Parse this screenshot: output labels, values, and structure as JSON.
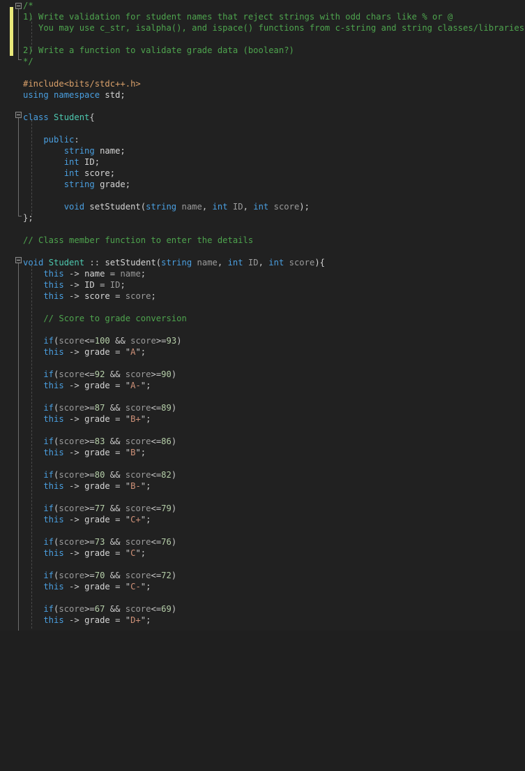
{
  "editor": {
    "language": "cpp",
    "theme": "dark",
    "background_color": "#212121",
    "change_indicator_color": "#E8E87A",
    "colors": {
      "comment": "#4EA44E",
      "keyword": "#4A9FE0",
      "type": "#4EC9B0",
      "string": "#CE9178",
      "number": "#B5CEA8",
      "identifier": "#D4D4D4",
      "parameter": "#9B9B9B",
      "punctuation": "#C8C8C8",
      "preprocessor": "#D9A06A"
    },
    "fold_markers": [
      {
        "name": "fold-comment-block",
        "line": 1
      },
      {
        "name": "fold-class-student",
        "line": 10
      },
      {
        "name": "fold-function-setstudent",
        "line": 23
      }
    ]
  },
  "code_lines": [
    "/*",
    "1) Write validation for student names that reject strings with odd chars like % or @",
    "   You may use c_str, isalpha(), and ispace() functions from c-string and string classes/libraries.",
    "",
    "",
    "2) Write a function to validate grade data (boolean?)",
    "*/",
    "",
    "#include<bits/stdc++.h>",
    "using namespace std;",
    "",
    "class Student{",
    "",
    "    public:",
    "        string name;",
    "        int ID;",
    "        int score;",
    "        string grade;",
    "",
    "        void setStudent(string name, int ID, int score);",
    "};",
    "",
    "// Class member function to enter the details",
    "",
    "void Student :: setStudent(string name, int ID, int score){",
    "    this -> name = name;",
    "    this -> ID = ID;",
    "    this -> score = score;",
    "",
    "    // Score to grade conversion",
    "",
    "    if(score<=100 && score>=93)",
    "    this -> grade = \"A\";",
    "",
    "    if(score<=92 && score>=90)",
    "    this -> grade = \"A-\";",
    "",
    "    if(score>=87 && score<=89)",
    "    this -> grade = \"B+\";",
    "",
    "    if(score>=83 && score<=86)",
    "    this -> grade = \"B\";",
    "",
    "    if(score>=80 && score<=82)",
    "    this -> grade = \"B-\";",
    "",
    "    if(score>=77 && score<=79)",
    "    this -> grade = \"C+\";",
    "",
    "    if(score>=73 && score<=76)",
    "    this -> grade = \"C\";",
    "",
    "    if(score>=70 && score<=72)",
    "    this -> grade = \"C-\";",
    "",
    "    if(score>=67 && score<=69)",
    "    this -> grade = \"D+\";"
  ],
  "grade_table": {
    "name": "score-to-grade-conversion",
    "rules": [
      {
        "grade": "A",
        "min": 93,
        "max": 100
      },
      {
        "grade": "A-",
        "min": 90,
        "max": 92
      },
      {
        "grade": "B+",
        "min": 87,
        "max": 89
      },
      {
        "grade": "B",
        "min": 83,
        "max": 86
      },
      {
        "grade": "B-",
        "min": 80,
        "max": 82
      },
      {
        "grade": "C+",
        "min": 77,
        "max": 79
      },
      {
        "grade": "C",
        "min": 73,
        "max": 76
      },
      {
        "grade": "C-",
        "min": 70,
        "max": 72
      },
      {
        "grade": "D+",
        "min": 67,
        "max": 69
      }
    ]
  },
  "tasks": [
    "1) Write validation for student names that reject strings with odd chars like % or @",
    "2) Write a function to validate grade data (boolean?)"
  ],
  "class_members": [
    {
      "type": "string",
      "name": "name"
    },
    {
      "type": "int",
      "name": "ID"
    },
    {
      "type": "int",
      "name": "score"
    },
    {
      "type": "string",
      "name": "grade"
    }
  ]
}
